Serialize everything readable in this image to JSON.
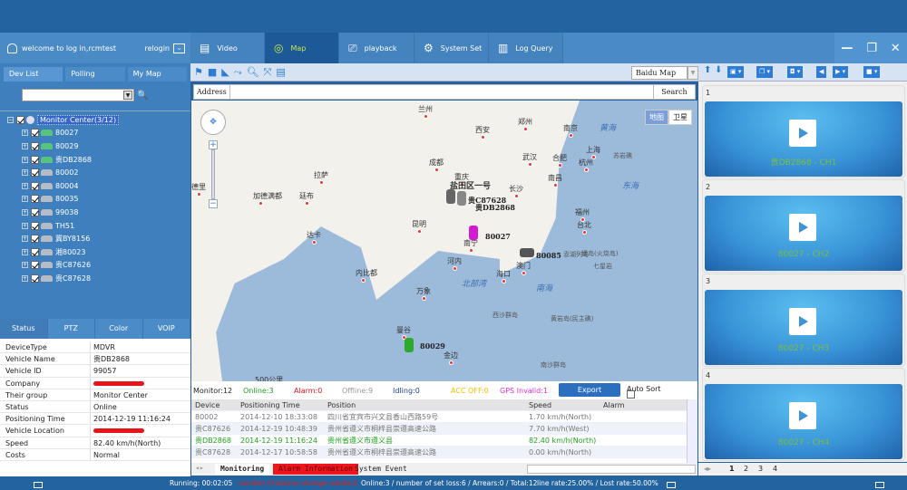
{
  "header": {
    "welcome": "welcome to log in,rcmtest",
    "relogin": "relogin",
    "tabs": [
      {
        "label": "Video",
        "icon": "film-icon"
      },
      {
        "label": "Map",
        "icon": "map-pin-icon",
        "active": true
      },
      {
        "label": "playback",
        "icon": "camera-icon"
      },
      {
        "label": "System Set",
        "icon": "gear-icon"
      },
      {
        "label": "Log Query",
        "icon": "document-icon"
      }
    ],
    "window_buttons": {
      "minimize": "—",
      "restore": "❐",
      "close": "✕"
    }
  },
  "left": {
    "tabs": [
      "Dev List",
      "Polling",
      "My Map"
    ],
    "search": {
      "value": "",
      "placeholder": ""
    },
    "tree": {
      "root": "Monitor Center(3/12)",
      "devices": [
        {
          "name": "80027",
          "online": true
        },
        {
          "name": "80029",
          "online": true
        },
        {
          "name": "贵DB2868",
          "online": true
        },
        {
          "name": "80002",
          "online": false
        },
        {
          "name": "80004",
          "online": false
        },
        {
          "name": "80035",
          "online": false
        },
        {
          "name": "99038",
          "online": false
        },
        {
          "name": "TH51",
          "online": false
        },
        {
          "name": "冀BY8156",
          "online": false
        },
        {
          "name": "湘80023",
          "online": false
        },
        {
          "name": "贵C87626",
          "online": false
        },
        {
          "name": "贵C87628",
          "online": false
        }
      ]
    }
  },
  "info": {
    "tabs": [
      "Status",
      "PTZ",
      "Color",
      "VOIP"
    ],
    "rows": [
      {
        "k": "DeviceType",
        "v": "MDVR"
      },
      {
        "k": "Vehicle Name",
        "v": "贵DB2868"
      },
      {
        "k": "Vehicle ID",
        "v": "99057"
      },
      {
        "k": "Company",
        "v": "",
        "redacted": true
      },
      {
        "k": "Their group",
        "v": "Monitor Center"
      },
      {
        "k": "Status",
        "v": "Online"
      },
      {
        "k": "Positioning Time",
        "v": "2014-12-19 11:16:24"
      },
      {
        "k": "Vehicle Location",
        "v": "",
        "redacted": true
      },
      {
        "k": "Speed",
        "v": "82.40 km/h(North)"
      },
      {
        "k": "Costs",
        "v": "Normal"
      }
    ]
  },
  "map": {
    "provider": "Baidu Map",
    "address_label": "Address",
    "address_value": "",
    "search_label": "Search",
    "map_types": [
      "地图",
      "卫星"
    ],
    "cities": [
      "兰州",
      "西安",
      "郑州",
      "南京",
      "上海",
      "合肥",
      "杭州",
      "武汉",
      "长沙",
      "南昌",
      "福州",
      "台北",
      "成都",
      "重庆",
      "昆明",
      "拉萨",
      "加德满都",
      "廷布",
      "达卡",
      "内比都",
      "河内",
      "海口",
      "万象",
      "曼谷",
      "金边",
      "澳门",
      "南宁",
      "德里"
    ],
    "seas": [
      "黄海",
      "东海",
      "南海",
      "北部湾"
    ],
    "islands": [
      "苏岩礁",
      "澎湖列岛",
      "绿岛(火烧岛)",
      "七星岩",
      "西沙群岛",
      "黄岩岛(民主礁)",
      "南沙群岛"
    ],
    "place_label": "盐田区一号",
    "vehicles": [
      "贵C87628",
      "贵DB2868",
      "80027",
      "80085",
      "80029"
    ],
    "scale": "500公里"
  },
  "counters": {
    "monitor": "Monitor:12",
    "online": "Online:3",
    "alarm": "Alarm:0",
    "offline": "Offline:9",
    "idling": "Idling:0",
    "acc_off": "ACC OFF:0",
    "gps_invalid": "GPS Invalid:1",
    "export": "Export",
    "auto_sort": "Auto Sort"
  },
  "table": {
    "columns": [
      "Device",
      "Positioning Time",
      "Position",
      "Speed",
      "Alarm"
    ],
    "rows": [
      {
        "device": "80002",
        "time": "2014-12-10 18:33:08",
        "position": "四川省宜宾市兴文县香山西路59号",
        "speed": "1.70 km/h(North)",
        "alarm": ""
      },
      {
        "device": "贵C87626",
        "time": "2014-12-19 10:48:39",
        "position": "贵州省遵义市桐梓县崇遵高速公路",
        "speed": "7.70 km/h(West)",
        "alarm": ""
      },
      {
        "device": "贵DB2868",
        "time": "2014-12-19 11:16:24",
        "position": "贵州省遵义市遵义县",
        "speed": "82.40 km/h(North)",
        "alarm": ""
      },
      {
        "device": "贵C87628",
        "time": "2014-12-17 10:58:58",
        "position": "贵州省遵义市桐梓县崇遵高速公路",
        "speed": "0.00 km/h(North)",
        "alarm": ""
      }
    ]
  },
  "bottom_tabs": [
    "Monitoring",
    "Alarm Information",
    "System Event"
  ],
  "video": {
    "cells": [
      {
        "num": "1",
        "label": "贵DB2868 - CH1"
      },
      {
        "num": "2",
        "label": "80027 - CH2"
      },
      {
        "num": "3",
        "label": "80027 - CH3"
      },
      {
        "num": "4",
        "label": "80027 - CH4"
      }
    ],
    "pages": [
      "1",
      "2",
      "3",
      "4"
    ]
  },
  "footer": {
    "running": "Running: 00:02:05",
    "alarms": "number of alarms storage media:0",
    "stats": "Online:3 / number of set loss:6 / Arrears:0 / Total:12",
    "rates": "line rate:25.00% / Lost rate:50.00%"
  },
  "colors": {
    "accent": "#24649e",
    "online": "#1fa21f",
    "alarm": "#f0141c",
    "gps_invalid": "#e52fd6",
    "acc_off": "#f2c200"
  }
}
